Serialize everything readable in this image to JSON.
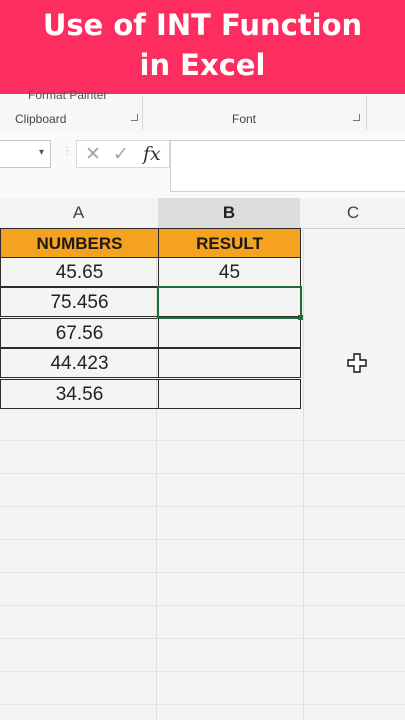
{
  "banner": {
    "line1": "Use of INT Function",
    "line2": "in Excel"
  },
  "ribbon": {
    "format_painter": "Format Painter",
    "clipboard_label": "Clipboard",
    "font_label": "Font"
  },
  "formula_bar": {
    "name_box_value": "",
    "cancel_symbol": "✕",
    "enter_symbol": "✓",
    "fx_label": "fx",
    "formula_value": ""
  },
  "columns": [
    "A",
    "B",
    "C"
  ],
  "selected_column": "B",
  "table": {
    "headers": [
      "NUMBERS",
      "RESULT"
    ],
    "rows": [
      [
        "45.65",
        "45"
      ],
      [
        "75.456",
        ""
      ],
      [
        "67.56",
        ""
      ],
      [
        "44.423",
        ""
      ],
      [
        "34.56",
        ""
      ]
    ]
  },
  "active_cell": "B3",
  "colors": {
    "banner": "#fe2d60",
    "header_fill": "#f4a21f",
    "active_border": "#1f6b3b"
  }
}
